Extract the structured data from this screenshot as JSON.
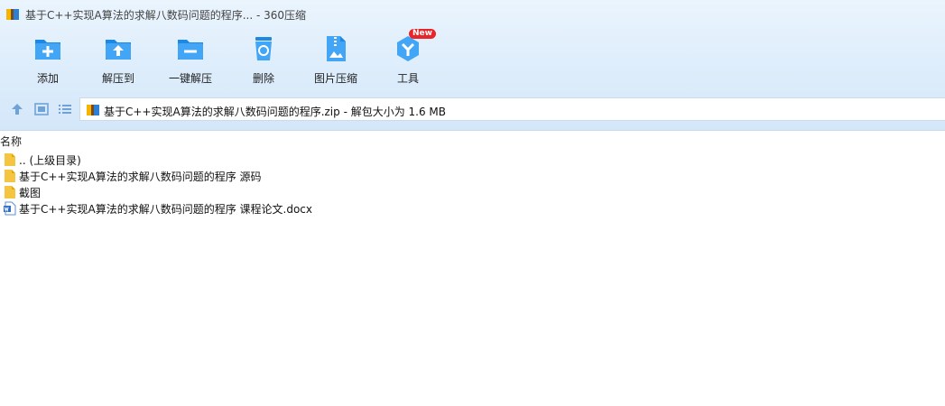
{
  "window": {
    "title": "基于C++实现A算法的求解八数码问题的程序... - 360压缩"
  },
  "toolbar": {
    "items": [
      {
        "label": "添加",
        "icon": "add-icon"
      },
      {
        "label": "解压到",
        "icon": "extract-to-icon"
      },
      {
        "label": "一键解压",
        "icon": "one-click-extract-icon"
      },
      {
        "label": "删除",
        "icon": "delete-icon"
      },
      {
        "label": "图片压缩",
        "icon": "image-compress-icon"
      },
      {
        "label": "工具",
        "icon": "tools-icon",
        "badge": "New"
      }
    ]
  },
  "nav": {
    "path": "基于C++实现A算法的求解八数码问题的程序.zip - 解包大小为 1.6 MB"
  },
  "file_list": {
    "column_name": "名称",
    "rows": [
      {
        "name": ".. (上级目录)",
        "type": "folder"
      },
      {
        "name": "基于C++实现A算法的求解八数码问题的程序 源码",
        "type": "folder"
      },
      {
        "name": "截图",
        "type": "folder"
      },
      {
        "name": "基于C++实现A算法的求解八数码问题的程序 课程论文.docx",
        "type": "word-document"
      }
    ]
  },
  "colors": {
    "accent": "#2196f3",
    "toolbar_bg": "#dcecfb",
    "badge": "#e8262a",
    "folder": "#f5c542"
  }
}
